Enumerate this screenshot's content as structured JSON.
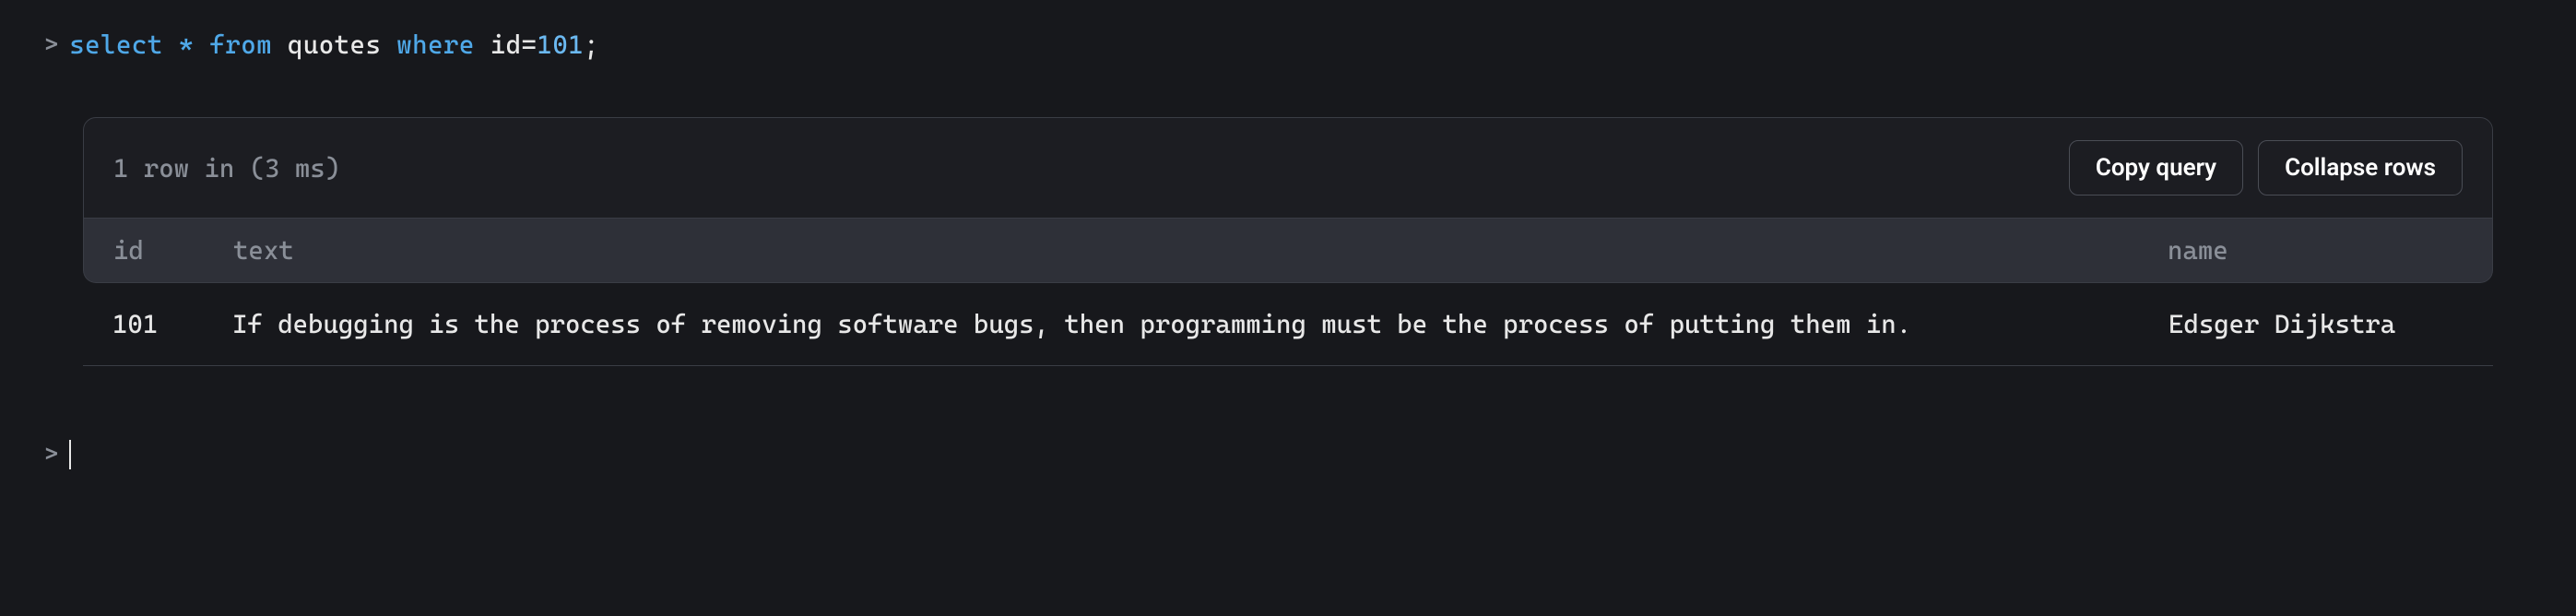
{
  "query": {
    "select": "select",
    "star": "*",
    "from": "from",
    "table": "quotes",
    "where": "where",
    "col": "id",
    "eq": "=",
    "num": "101",
    "semi": ";"
  },
  "result": {
    "status": "1 row in (3 ms)",
    "buttons": {
      "copy": "Copy query",
      "collapse": "Collapse rows"
    },
    "columns": {
      "id": "id",
      "text": "text",
      "name": "name"
    },
    "rows": [
      {
        "id": "101",
        "text": "If debugging is the process of removing software bugs, then programming must be the process of putting them in.",
        "name": "Edsger Dijkstra"
      }
    ]
  },
  "prompt": ">"
}
